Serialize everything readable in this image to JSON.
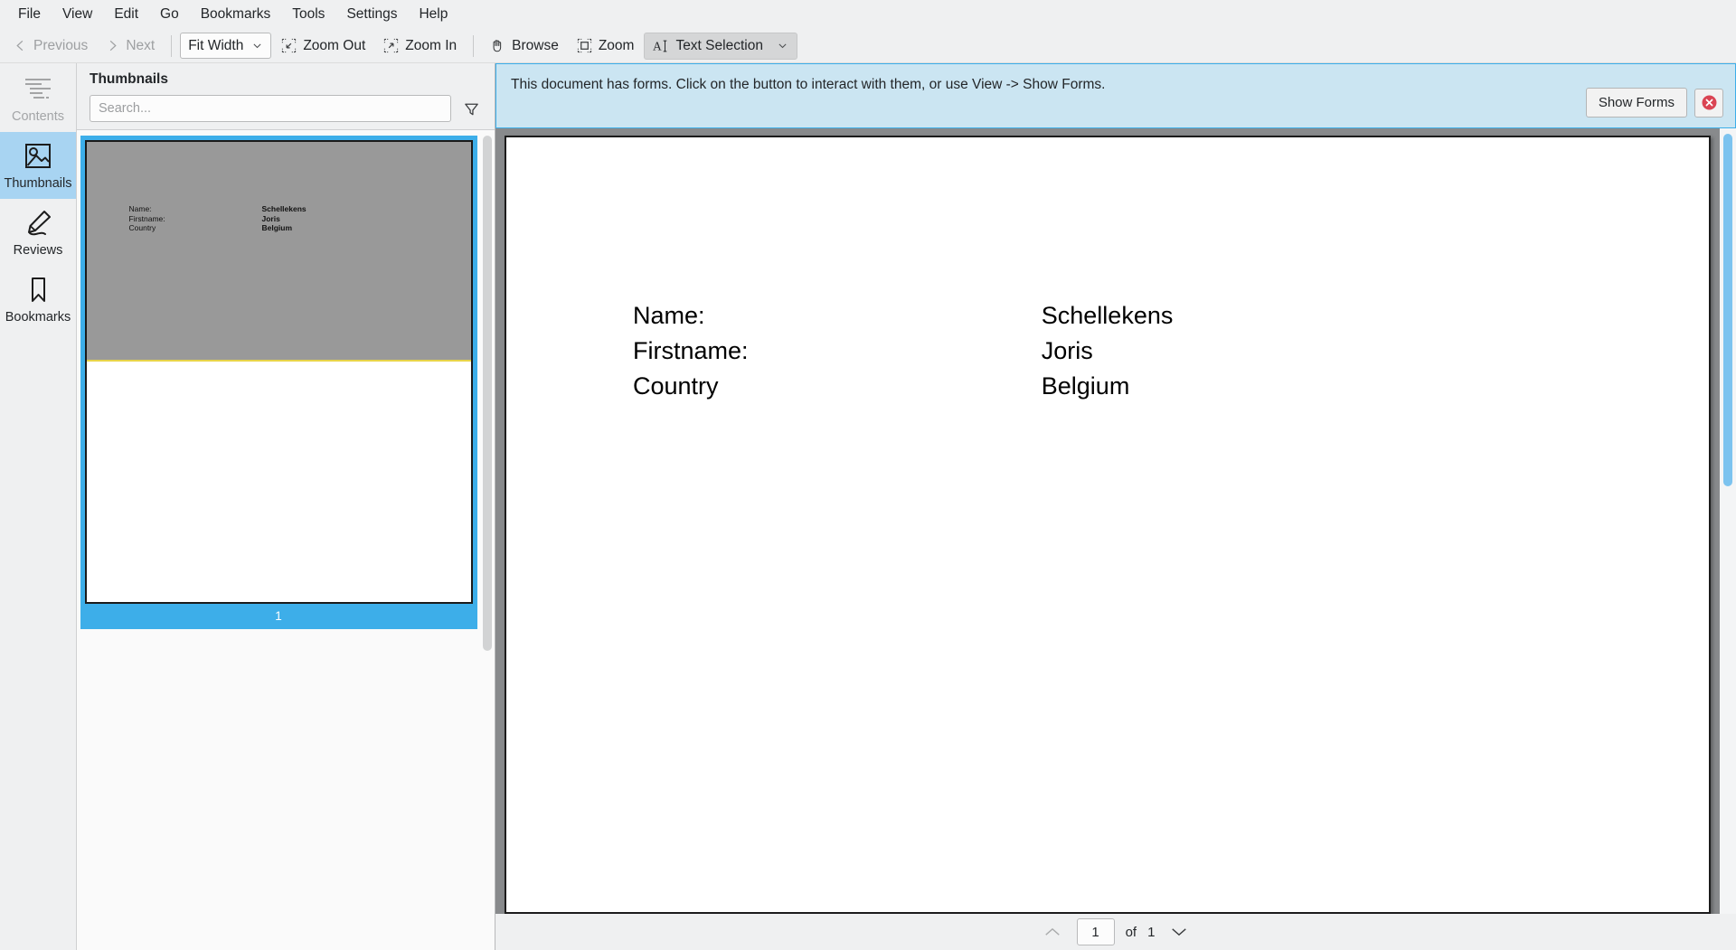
{
  "menubar": {
    "items": [
      {
        "label": "File"
      },
      {
        "label": "View"
      },
      {
        "label": "Edit"
      },
      {
        "label": "Go"
      },
      {
        "label": "Bookmarks"
      },
      {
        "label": "Tools"
      },
      {
        "label": "Settings"
      },
      {
        "label": "Help"
      }
    ]
  },
  "toolbar": {
    "previous_label": "Previous",
    "next_label": "Next",
    "zoom_select_value": "Fit Width",
    "zoom_out_label": "Zoom Out",
    "zoom_in_label": "Zoom In",
    "browse_label": "Browse",
    "zoom_label": "Zoom",
    "text_selection_label": "Text Selection"
  },
  "sidebar": {
    "items": [
      {
        "label": "Contents",
        "icon": "contents-icon",
        "state": "disabled"
      },
      {
        "label": "Thumbnails",
        "icon": "thumbnails-icon",
        "state": "selected"
      },
      {
        "label": "Reviews",
        "icon": "reviews-icon",
        "state": "normal"
      },
      {
        "label": "Bookmarks",
        "icon": "bookmarks-icon",
        "state": "normal"
      }
    ]
  },
  "thumbnails_panel": {
    "title": "Thumbnails",
    "search_placeholder": "Search...",
    "search_value": "",
    "filter_icon": "funnel-filter-icon",
    "pages": [
      {
        "number": "1",
        "selected": true,
        "preview_rows": [
          {
            "label": "Name:",
            "value": "Schellekens"
          },
          {
            "label": "Firstname:",
            "value": "Joris"
          },
          {
            "label": "Country",
            "value": "Belgium"
          }
        ]
      }
    ]
  },
  "notification": {
    "message": "This document has forms. Click on the button to interact with them, or use View -> Show Forms.",
    "action_label": "Show Forms",
    "close_icon": "close-circle-icon",
    "accent_color": "#3daee9",
    "background_color": "#cbe5f2",
    "close_icon_color": "#da4453"
  },
  "document": {
    "rows": [
      {
        "label": "Name:",
        "value": "Schellekens"
      },
      {
        "label": "Firstname:",
        "value": "Joris"
      },
      {
        "label": "Country",
        "value": "Belgium"
      }
    ]
  },
  "page_nav": {
    "prev_icon": "chevron-up-icon",
    "next_icon": "chevron-down-icon",
    "current_page": "1",
    "of_label": "of",
    "total_pages": "1"
  }
}
